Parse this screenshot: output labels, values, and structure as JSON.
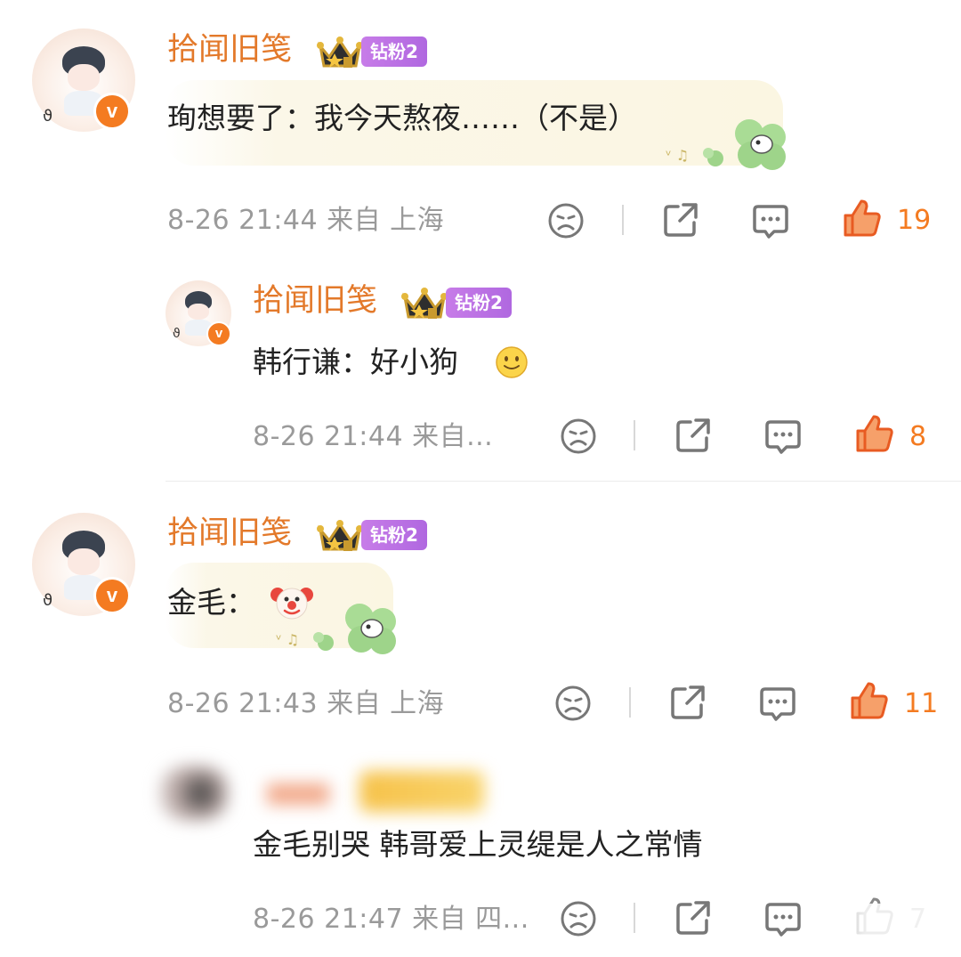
{
  "comments": [
    {
      "user": "拾闻旧笺",
      "fan_badge": "钻粉2",
      "text": "珣想要了：我今天熬夜……（不是）",
      "meta": "8-26 21:44 来自 上海",
      "likes": "19"
    },
    {
      "user": "拾闻旧笺",
      "fan_badge": "钻粉2",
      "text": "韩行谦：好小狗",
      "meta": "8-26 21:44 来自...",
      "likes": "8"
    },
    {
      "user": "拾闻旧笺",
      "fan_badge": "钻粉2",
      "text": "金毛：",
      "meta": "8-26 21:43 来自 上海",
      "likes": "11"
    },
    {
      "user": "",
      "fan_badge": "",
      "text": "金毛别哭 韩哥爱上灵缇是人之常情",
      "meta": "8-26 21:47 来自 四...",
      "likes": "7"
    }
  ],
  "colors": {
    "accent": "#f47b21",
    "name": "#e3792a",
    "meta": "#9a9a9a",
    "fan_badge": "#b96ee3"
  },
  "icons": [
    "verified-badge-icon",
    "crown-icon",
    "sad-face-icon",
    "share-icon",
    "comment-icon",
    "thumbs-up-icon",
    "smile-emoji",
    "clown-emoji",
    "clover-sticker"
  ]
}
